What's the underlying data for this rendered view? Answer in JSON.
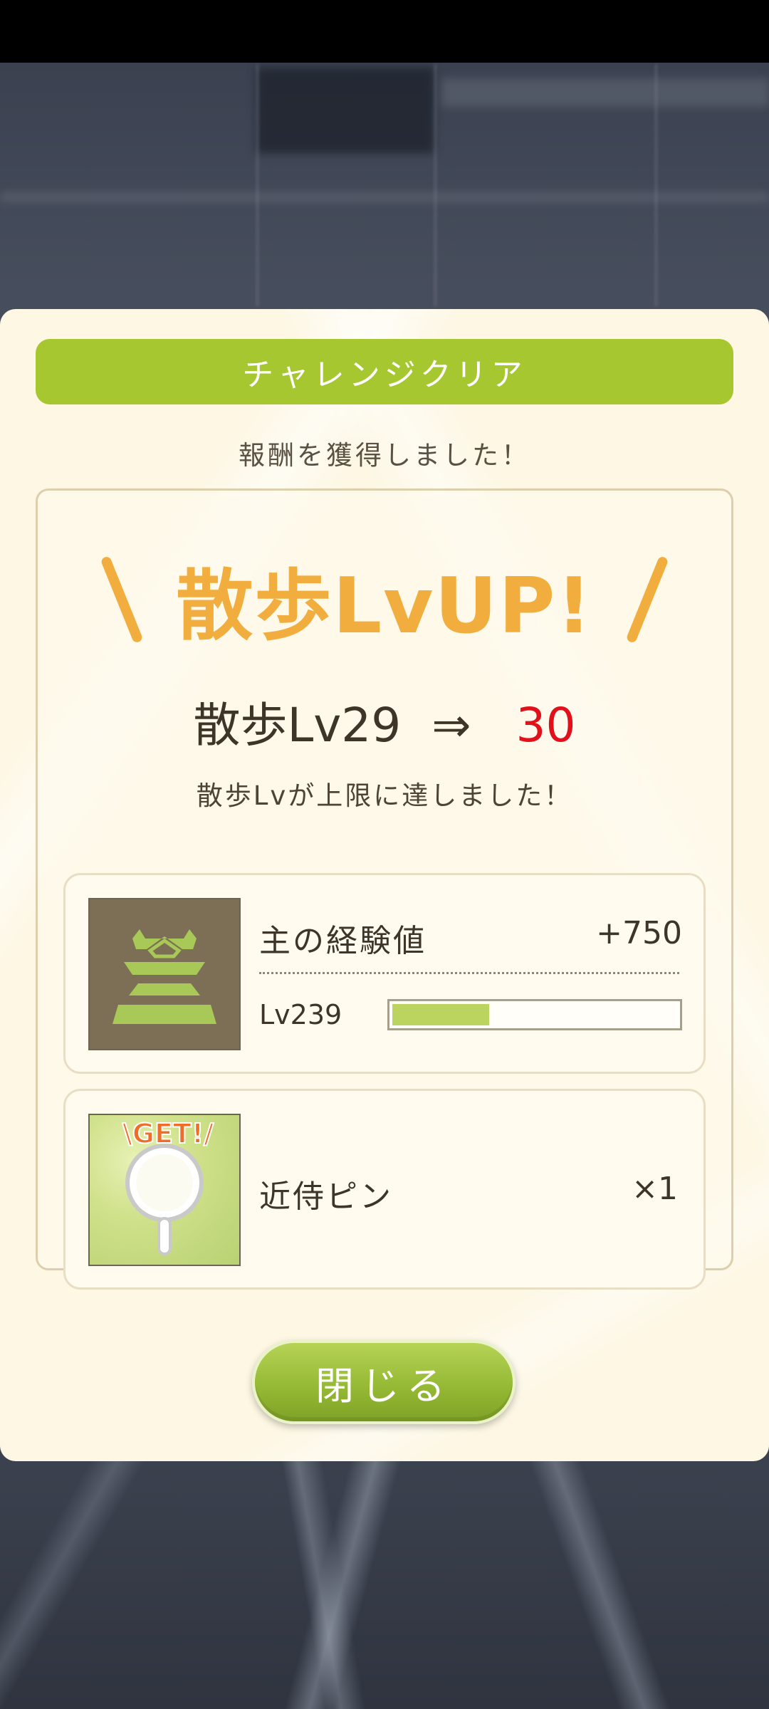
{
  "dialog": {
    "header": "チャレンジクリア",
    "subtitle": "報酬を獲得しました！",
    "lvup_title": "散歩LvUP!",
    "level_change": {
      "from": "散歩Lv29",
      "arrow": "⇒",
      "to": "30"
    },
    "limit_note": "散歩Lvが上限に達しました！",
    "rewards": [
      {
        "name": "主の経験値",
        "amount": "+750",
        "level": "Lv239",
        "progress": 0.34,
        "icon": "castle-icon"
      },
      {
        "name": "近侍ピン",
        "quantity": "×1",
        "badge": "\\GET!/",
        "icon": "pin-icon"
      }
    ],
    "close_label": "閉じる"
  },
  "colors": {
    "accent_green": "#a6c72f",
    "lvup_orange": "#f1ae3e",
    "level_red": "#e1101b",
    "dialog_bg": "#fdf7e3"
  }
}
